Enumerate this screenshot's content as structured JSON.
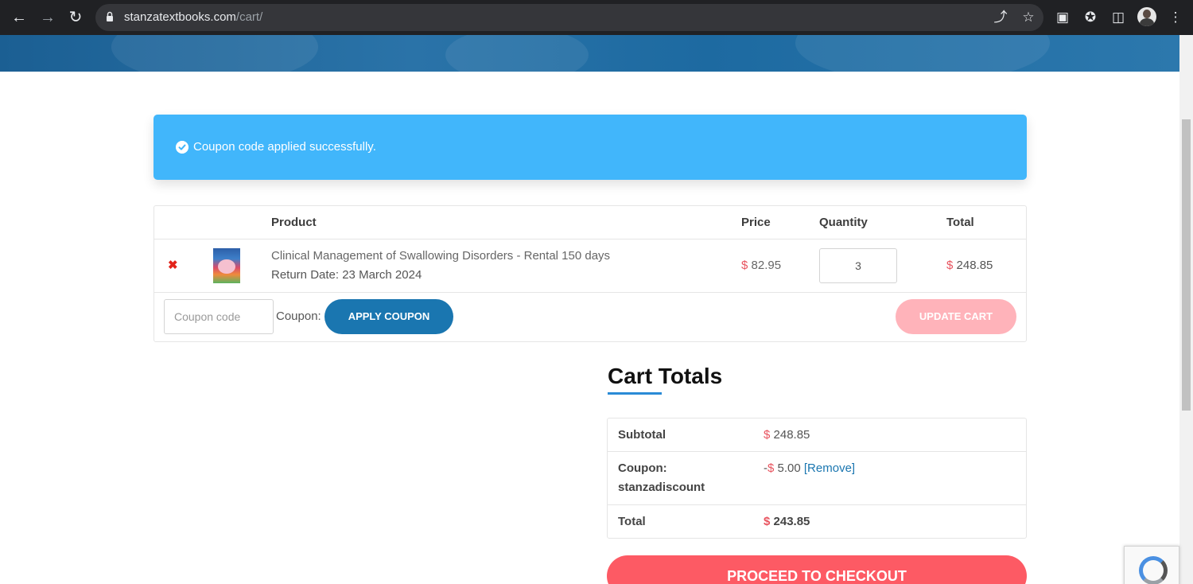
{
  "browser": {
    "url_host": "stanzatextbooks.com",
    "url_path": "/cart/"
  },
  "notice": {
    "message": "Coupon code applied successfully."
  },
  "cart": {
    "headers": {
      "product": "Product",
      "price": "Price",
      "quantity": "Quantity",
      "total": "Total"
    },
    "items": [
      {
        "name": "Clinical Management of Swallowing Disorders - Rental 150 days",
        "return_label": "Return Date:",
        "return_date": "23 March 2024",
        "currency": "$",
        "price": "82.95",
        "quantity": "3",
        "total": "248.85"
      }
    ],
    "coupon_placeholder": "Coupon code",
    "coupon_label": "Coupon:",
    "apply_label": "Apply coupon",
    "update_label": "Update cart"
  },
  "totals": {
    "title": "Cart Totals",
    "subtotal_label": "Subtotal",
    "subtotal_value": "248.85",
    "coupon_label_line1": "Coupon:",
    "coupon_label_line2": "stanzadiscount",
    "coupon_prefix": "-",
    "coupon_value": "5.00",
    "coupon_remove": "[Remove]",
    "total_label": "Total",
    "total_value": "243.85",
    "currency": "$"
  },
  "checkout": {
    "label": "Proceed to checkout"
  },
  "colors": {
    "notice_bg": "#41b6fb",
    "primary_button": "#1a76b0",
    "checkout_button": "#fd5a64",
    "currency_symbol": "#e8545f"
  }
}
